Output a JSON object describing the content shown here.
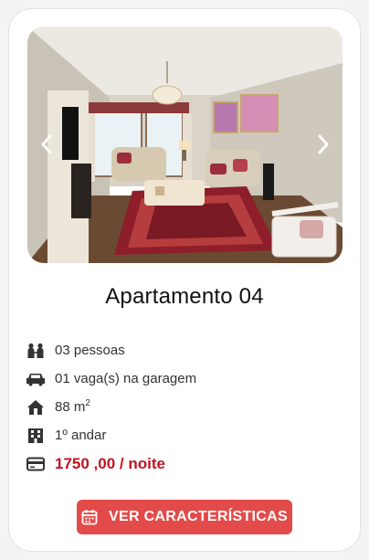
{
  "listing": {
    "title": "Apartamento 04",
    "photo_alt": "Sala de estar com sofás bege, tapete persa vermelho e lustre de cristal",
    "features": [
      {
        "icon": "people-icon",
        "text": "03 pessoas"
      },
      {
        "icon": "car-icon",
        "text": "01 vaga(s) na garagem"
      },
      {
        "icon": "house-icon",
        "text": "88 m",
        "sup": "2"
      },
      {
        "icon": "building-icon",
        "text": "1º andar"
      },
      {
        "icon": "card-icon",
        "text": "1750 ,00 / noite"
      }
    ],
    "cta_label": "VER CARACTERÍSTICAS"
  },
  "colors": {
    "accent": "#e34a4a",
    "price": "#c1121f"
  },
  "icons": {
    "prev": "chevron-left-icon",
    "next": "chevron-right-icon",
    "cta": "calendar-icon"
  }
}
